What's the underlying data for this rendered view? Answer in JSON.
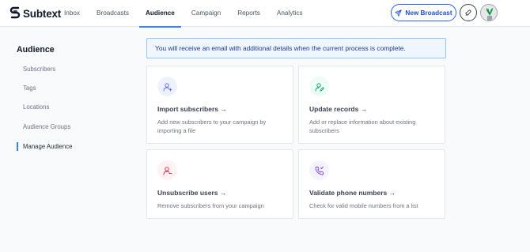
{
  "app": {
    "name": "Subtext"
  },
  "nav": {
    "items": [
      "Inbox",
      "Broadcasts",
      "Audience",
      "Campaign",
      "Reports",
      "Analytics"
    ],
    "active": "Audience"
  },
  "header": {
    "new_broadcast_label": "New Broadcast"
  },
  "sidebar": {
    "title": "Audience",
    "items": [
      {
        "label": "Subscribers"
      },
      {
        "label": "Tags"
      },
      {
        "label": "Locations"
      },
      {
        "label": "Audience Groups"
      },
      {
        "label": "Manage Audience",
        "active": true
      }
    ]
  },
  "alert": {
    "text": "You will receive an email with additional details when the current process is complete."
  },
  "cards": [
    {
      "title": "Import subscribers →",
      "description": "Add new subscribers to your campaign by importing a file",
      "icon": "user-plus-icon"
    },
    {
      "title": "Update records →",
      "description": "Add or replace information about existing subscribers",
      "icon": "user-edit-icon"
    },
    {
      "title": "Unsubscribe users →",
      "description": "Remove subscribers from your campaign",
      "icon": "user-minus-icon"
    },
    {
      "title": "Validate phone numbers →",
      "description": "Check for valid mobile numbers from a list",
      "icon": "phone-icon"
    }
  ],
  "colors": {
    "accent": "#3b82f6",
    "primary_button": "#2563eb",
    "alert_bg": "#eff6ff",
    "alert_border": "#93c5fd",
    "icon_bg_blue": "#eef2ff",
    "icon_bg_green": "#ecfdf5",
    "icon_bg_red": "#fef2f2",
    "icon_bg_purple": "#f5f3ff"
  }
}
